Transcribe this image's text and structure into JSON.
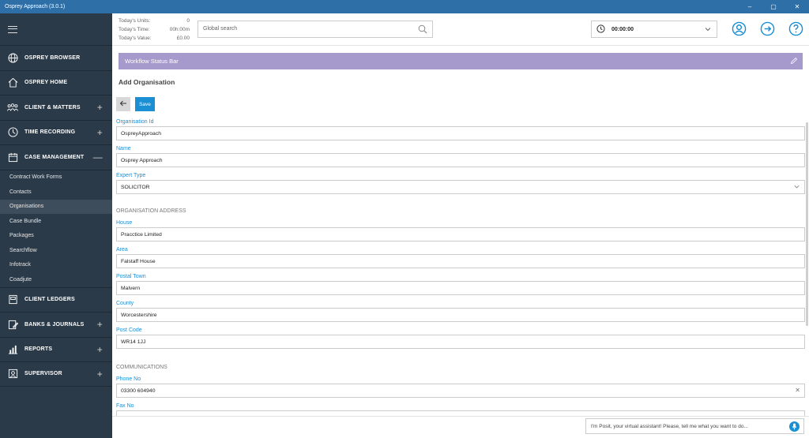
{
  "window": {
    "title": "Osprey Approach (3.0.1)",
    "minimize": "–",
    "maximize": "▢",
    "close": "✕"
  },
  "sidebar": {
    "nav": [
      {
        "id": "osprey-browser",
        "label": "OSPREY BROWSER",
        "icon": "globe-icon",
        "expand": ""
      },
      {
        "id": "osprey-home",
        "label": "OSPREY HOME",
        "icon": "home-icon",
        "expand": ""
      },
      {
        "id": "client-matters",
        "label": "CLIENT & MATTERS",
        "icon": "people-icon",
        "expand": "+"
      },
      {
        "id": "time-recording",
        "label": "TIME RECORDING",
        "icon": "clock-icon",
        "expand": "+"
      },
      {
        "id": "case-management",
        "label": "CASE MANAGEMENT",
        "icon": "calendar-icon",
        "expand": "—"
      }
    ],
    "sub_items": [
      "Contract Work Forms",
      "Contacts",
      "Organisations",
      "Case Bundle",
      "Packages",
      "Searchflow",
      "Infotrack",
      "Coadjute"
    ],
    "active_sub": "Organisations",
    "nav2": [
      {
        "id": "client-ledgers",
        "label": "CLIENT LEDGERS",
        "icon": "ledger-icon",
        "expand": ""
      },
      {
        "id": "banks-journals",
        "label": "BANKS & JOURNALS",
        "icon": "bank-icon",
        "expand": "+"
      },
      {
        "id": "reports",
        "label": "REPORTS",
        "icon": "chart-icon",
        "expand": "+"
      },
      {
        "id": "supervisor",
        "label": "SUPERVISOR",
        "icon": "supervisor-icon",
        "expand": "+"
      }
    ]
  },
  "topbar": {
    "stats": [
      {
        "label": "Today's Units:",
        "value": "0"
      },
      {
        "label": "Today's Time:",
        "value": "00h:00m"
      },
      {
        "label": "Today's Value:",
        "value": "£0.00"
      }
    ],
    "search_placeholder": "Global search",
    "timer": "00:00:00"
  },
  "workflow_label": "Workflow Status Bar",
  "page_title": "Add Organisation",
  "save_label": "Save",
  "fields": {
    "org_id": {
      "label": "Organisation Id",
      "value": "OspreyApproach"
    },
    "name": {
      "label": "Name",
      "value": "Osprey Approach"
    },
    "expert_type": {
      "label": "Expert Type",
      "value": "SOLICITOR"
    }
  },
  "address_heading": "ORGANISATION ADDRESS",
  "address": {
    "house": {
      "label": "House",
      "value": "Pracctice Limited"
    },
    "area": {
      "label": "Area",
      "value": "Falstaff House"
    },
    "postal_town": {
      "label": "Postal Town",
      "value": "Malvern"
    },
    "county": {
      "label": "County",
      "value": "Worcestershire"
    },
    "post_code": {
      "label": "Post Code",
      "value": "WR14 1JJ"
    }
  },
  "comms_heading": "COMMUNICATIONS",
  "comms": {
    "phone": {
      "label": "Phone No",
      "value": "03300 604940"
    },
    "fax": {
      "label": "Fax No",
      "value": ""
    }
  },
  "assistant_placeholder": "I'm Posit, your virtual assistant! Please, tell me what you want to do...",
  "colors": {
    "titlebar": "#2f6fa8",
    "sidebar": "#2b3a48",
    "accent": "#1a8fd4",
    "workflow": "#a699cc"
  }
}
